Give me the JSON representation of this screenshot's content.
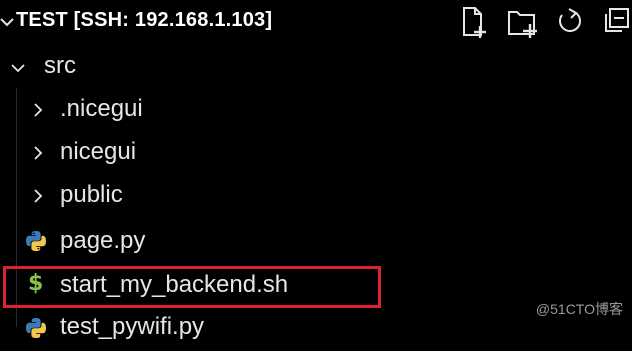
{
  "explorer": {
    "title": "TEST [SSH: 192.168.1.103]",
    "toolbar": {
      "new_file_icon": "new-file-icon",
      "new_folder_icon": "new-folder-icon",
      "refresh_icon": "refresh-icon",
      "collapse_all_icon": "collapse-all-icon"
    },
    "tree": {
      "root": {
        "label": "src",
        "expanded": true
      },
      "items": [
        {
          "label": ".nicegui",
          "type": "folder",
          "expanded": false
        },
        {
          "label": "nicegui",
          "type": "folder",
          "expanded": false
        },
        {
          "label": "public",
          "type": "folder",
          "expanded": false
        },
        {
          "label": "page.py",
          "type": "file",
          "icon": "python-icon"
        },
        {
          "label": "start_my_backend.sh",
          "type": "file",
          "icon": "shell-dollar-icon",
          "highlighted": true
        },
        {
          "label": "test_pywifi.py",
          "type": "file",
          "icon": "python-icon"
        }
      ]
    }
  },
  "colors": {
    "background": "#000000",
    "text": "#e6e6e6",
    "highlight_border": "#e0202a",
    "shell_icon": "#8bc34a",
    "python_blue": "#3d7ab8",
    "python_yellow": "#f2c94c"
  },
  "watermark": "@51CTO博客"
}
